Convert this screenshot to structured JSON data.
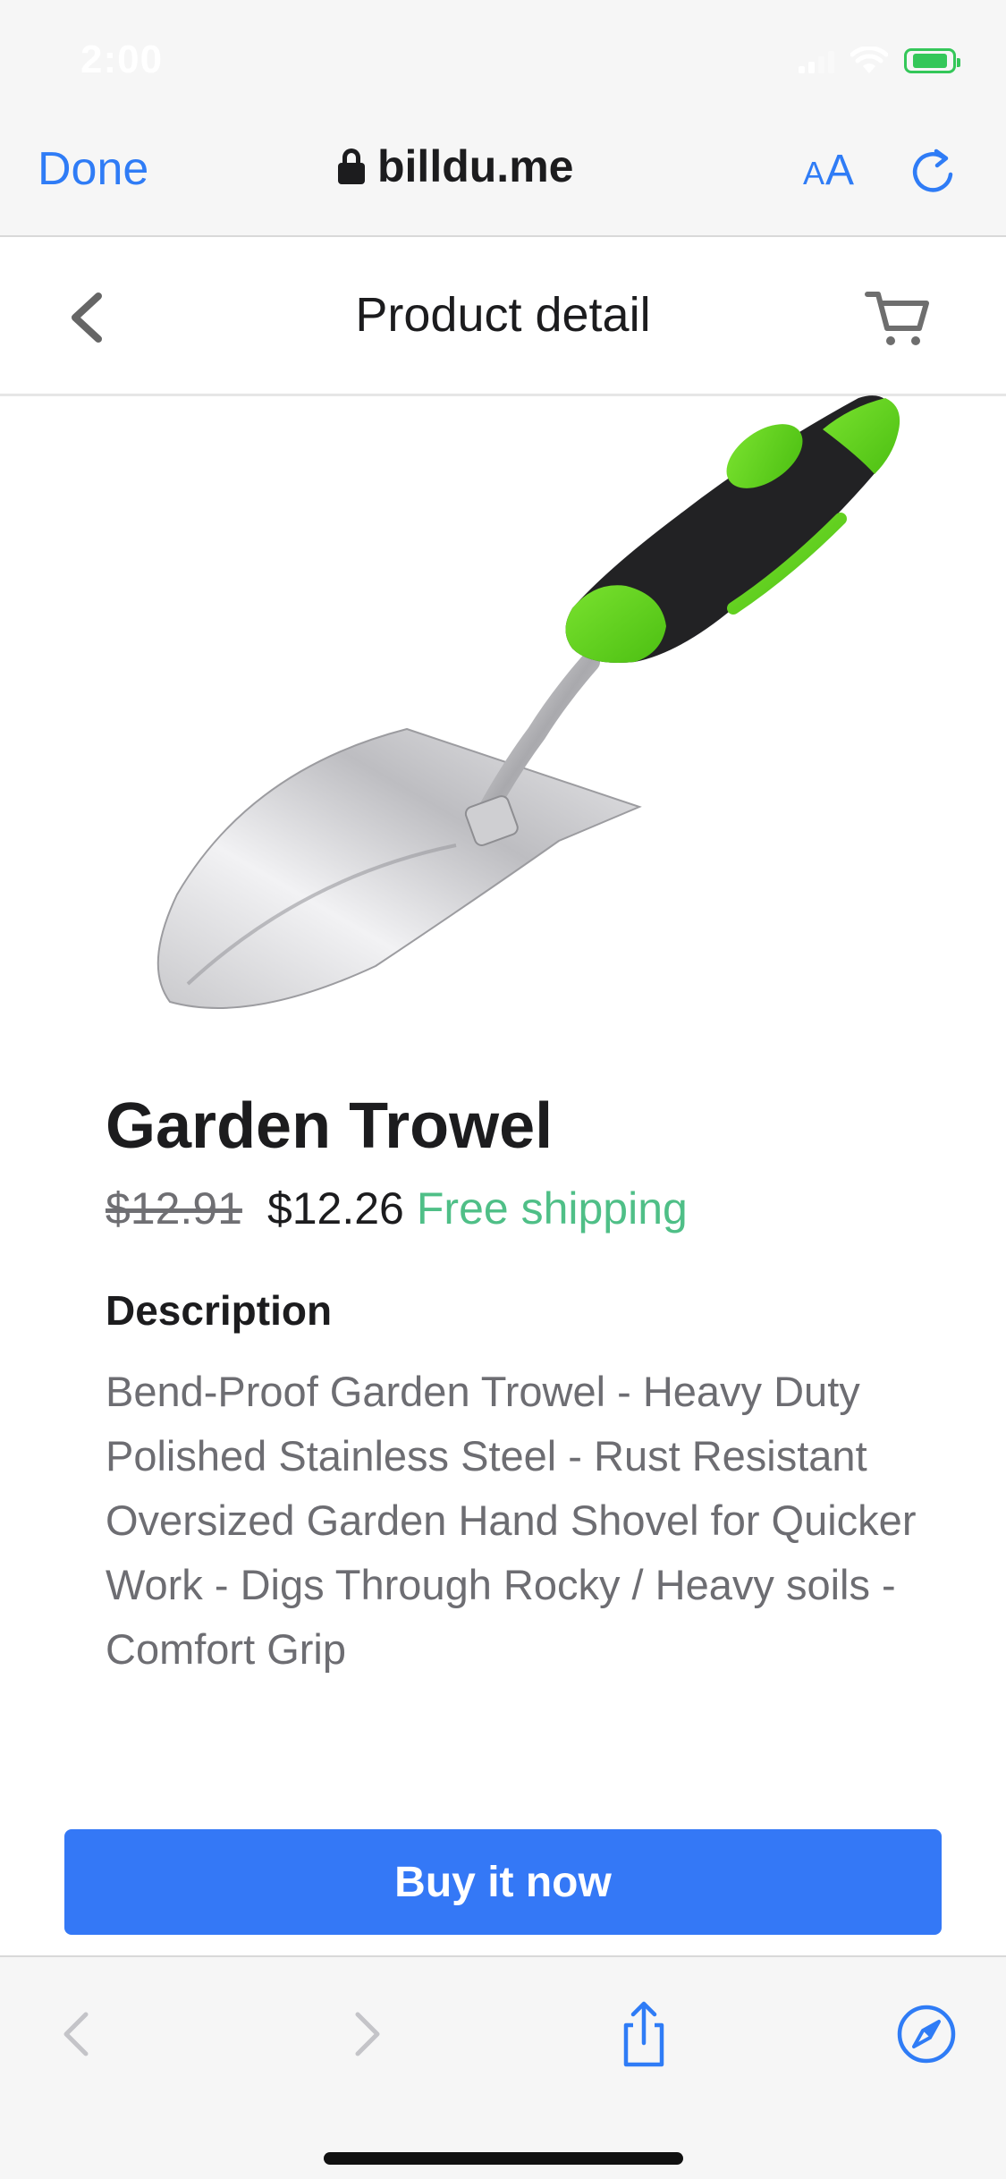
{
  "status_bar": {
    "time": "2:00"
  },
  "browser": {
    "done_label": "Done",
    "url": "billdu.me",
    "text_size_label_small": "A",
    "text_size_label_large": "A"
  },
  "header": {
    "title": "Product detail"
  },
  "product": {
    "name": "Garden Trowel",
    "price_original": "$12.91",
    "price_current": "$12.26",
    "shipping": "Free shipping",
    "description_heading": "Description",
    "description": "Bend-Proof Garden Trowel - Heavy Duty Polished Stainless Steel - Rust Resistant Oversized Garden Hand Shovel for Quicker Work - Digs Through Rocky / Heavy soils - Comfort Grip"
  },
  "buy_button": {
    "label": "Buy it now"
  },
  "icons": {
    "lock": "lock-icon",
    "reload": "reload-icon",
    "back": "chevron-left-icon",
    "cart": "cart-icon",
    "nav_back": "arrow-left-icon",
    "nav_forward": "arrow-right-icon",
    "share": "share-icon",
    "compass": "compass-icon"
  },
  "colors": {
    "accent": "#2f7cf6",
    "buy_button": "#3478f6",
    "shipping_green": "#4fbf87",
    "handle_green": "#5ed31a"
  }
}
